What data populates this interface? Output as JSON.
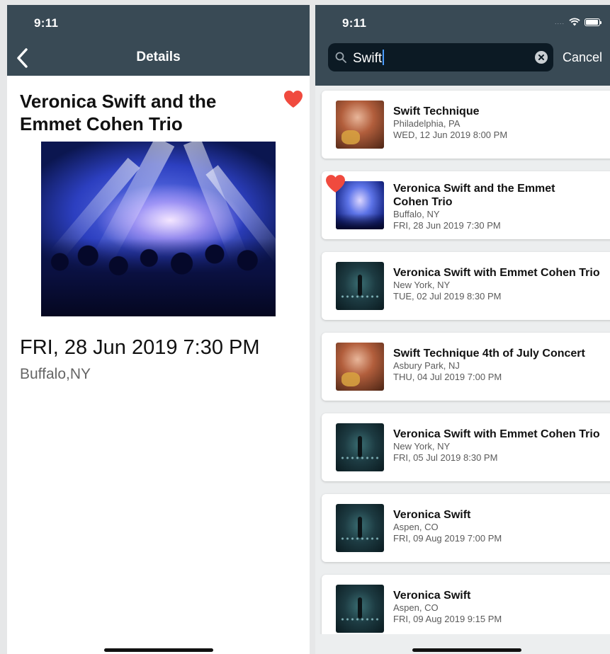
{
  "left": {
    "status_time": "9:11",
    "nav_title": "Details",
    "title": "Veronica Swift and the Emmet Cohen Trio",
    "date": "FRI, 28 Jun 2019 7:30 PM",
    "location": "Buffalo,NY",
    "favorite": true
  },
  "right": {
    "status_time": "9:11",
    "search_query": "Swift",
    "cancel_label": "Cancel",
    "results": [
      {
        "title": "Swift Technique",
        "location": "Philadelphia, PA",
        "date": "WED, 12 Jun 2019 8:00 PM",
        "thumb": "band",
        "favorite": false
      },
      {
        "title": "Veronica Swift and the Emmet Cohen Trio",
        "location": "Buffalo, NY",
        "date": "FRI, 28 Jun 2019 7:30 PM",
        "thumb": "concert",
        "favorite": true
      },
      {
        "title": "Veronica Swift with Emmet Cohen Trio",
        "location": "New York, NY",
        "date": "TUE, 02 Jul 2019 8:30 PM",
        "thumb": "dark",
        "favorite": false
      },
      {
        "title": "Swift Technique 4th of July Concert",
        "location": "Asbury Park, NJ",
        "date": "THU, 04 Jul 2019 7:00 PM",
        "thumb": "band",
        "favorite": false
      },
      {
        "title": "Veronica Swift with Emmet Cohen Trio",
        "location": "New York, NY",
        "date": "FRI, 05 Jul 2019 8:30 PM",
        "thumb": "dark",
        "favorite": false
      },
      {
        "title": "Veronica Swift",
        "location": "Aspen, CO",
        "date": "FRI, 09 Aug 2019 7:00 PM",
        "thumb": "dark",
        "favorite": false
      },
      {
        "title": "Veronica Swift",
        "location": "Aspen, CO",
        "date": "FRI, 09 Aug 2019 9:15 PM",
        "thumb": "dark",
        "favorite": false
      }
    ]
  },
  "colors": {
    "nav_background": "#394a55",
    "search_field": "#0c1a24",
    "heart": "#f04a3e",
    "list_background": "#eceeef"
  }
}
